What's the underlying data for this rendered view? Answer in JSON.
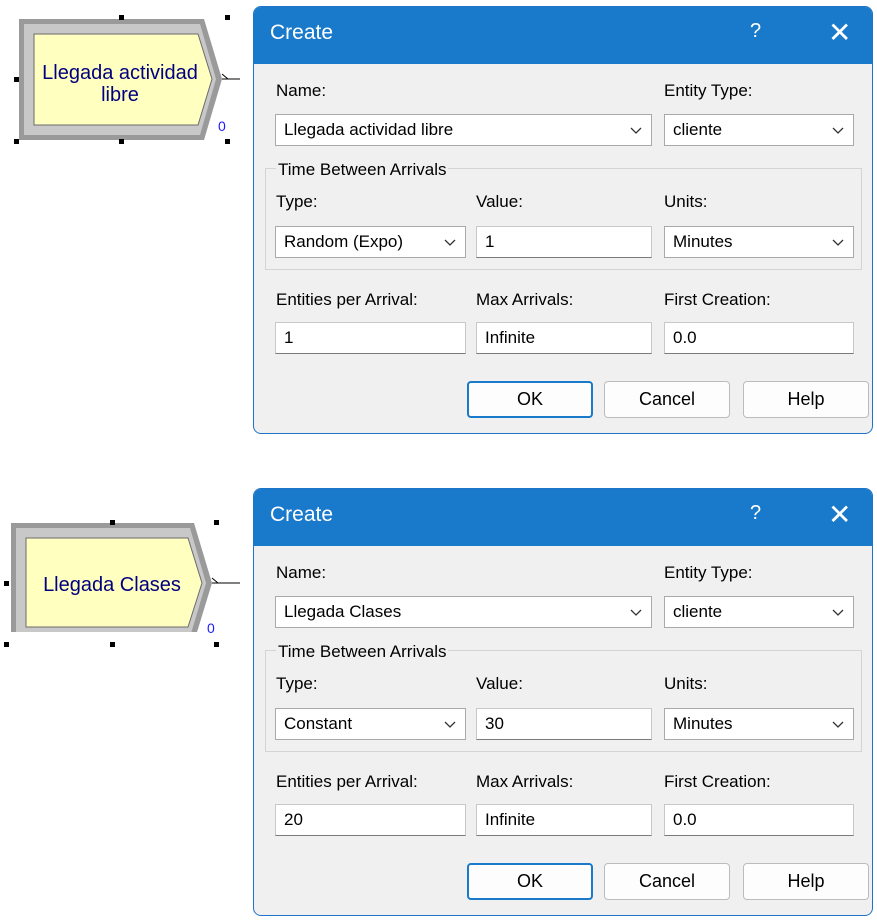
{
  "colors": {
    "titlebar": "#1979ca",
    "module_fill": "#ffffc0",
    "module_text": "#000080"
  },
  "dialogs": [
    {
      "module": {
        "label_line1": "Llegada actividad",
        "label_line2": "libre",
        "counter": "0"
      },
      "title": "Create",
      "help_symbol": "?",
      "close_symbol": "✕",
      "name_label": "Name:",
      "name_value": "Llegada actividad libre",
      "entity_type_label": "Entity Type:",
      "entity_type_value": "cliente",
      "group_title": "Time Between Arrivals",
      "type_label": "Type:",
      "type_value": "Random (Expo)",
      "value_label": "Value:",
      "value_value": "1",
      "units_label": "Units:",
      "units_value": "Minutes",
      "entities_label": "Entities per Arrival:",
      "entities_value": "1",
      "max_label": "Max Arrivals:",
      "max_value": "Infinite",
      "first_label": "First Creation:",
      "first_value": "0.0",
      "ok_label": "OK",
      "cancel_label": "Cancel",
      "help_label": "Help"
    },
    {
      "module": {
        "label_line1": "Llegada Clases",
        "label_line2": "",
        "counter": "0"
      },
      "title": "Create",
      "help_symbol": "?",
      "close_symbol": "✕",
      "name_label": "Name:",
      "name_value": "Llegada Clases",
      "entity_type_label": "Entity Type:",
      "entity_type_value": "cliente",
      "group_title": "Time Between Arrivals",
      "type_label": "Type:",
      "type_value": "Constant",
      "value_label": "Value:",
      "value_value": "30",
      "units_label": "Units:",
      "units_value": "Minutes",
      "entities_label": "Entities per Arrival:",
      "entities_value": "20",
      "max_label": "Max Arrivals:",
      "max_value": "Infinite",
      "first_label": "First Creation:",
      "first_value": "0.0",
      "ok_label": "OK",
      "cancel_label": "Cancel",
      "help_label": "Help"
    }
  ]
}
